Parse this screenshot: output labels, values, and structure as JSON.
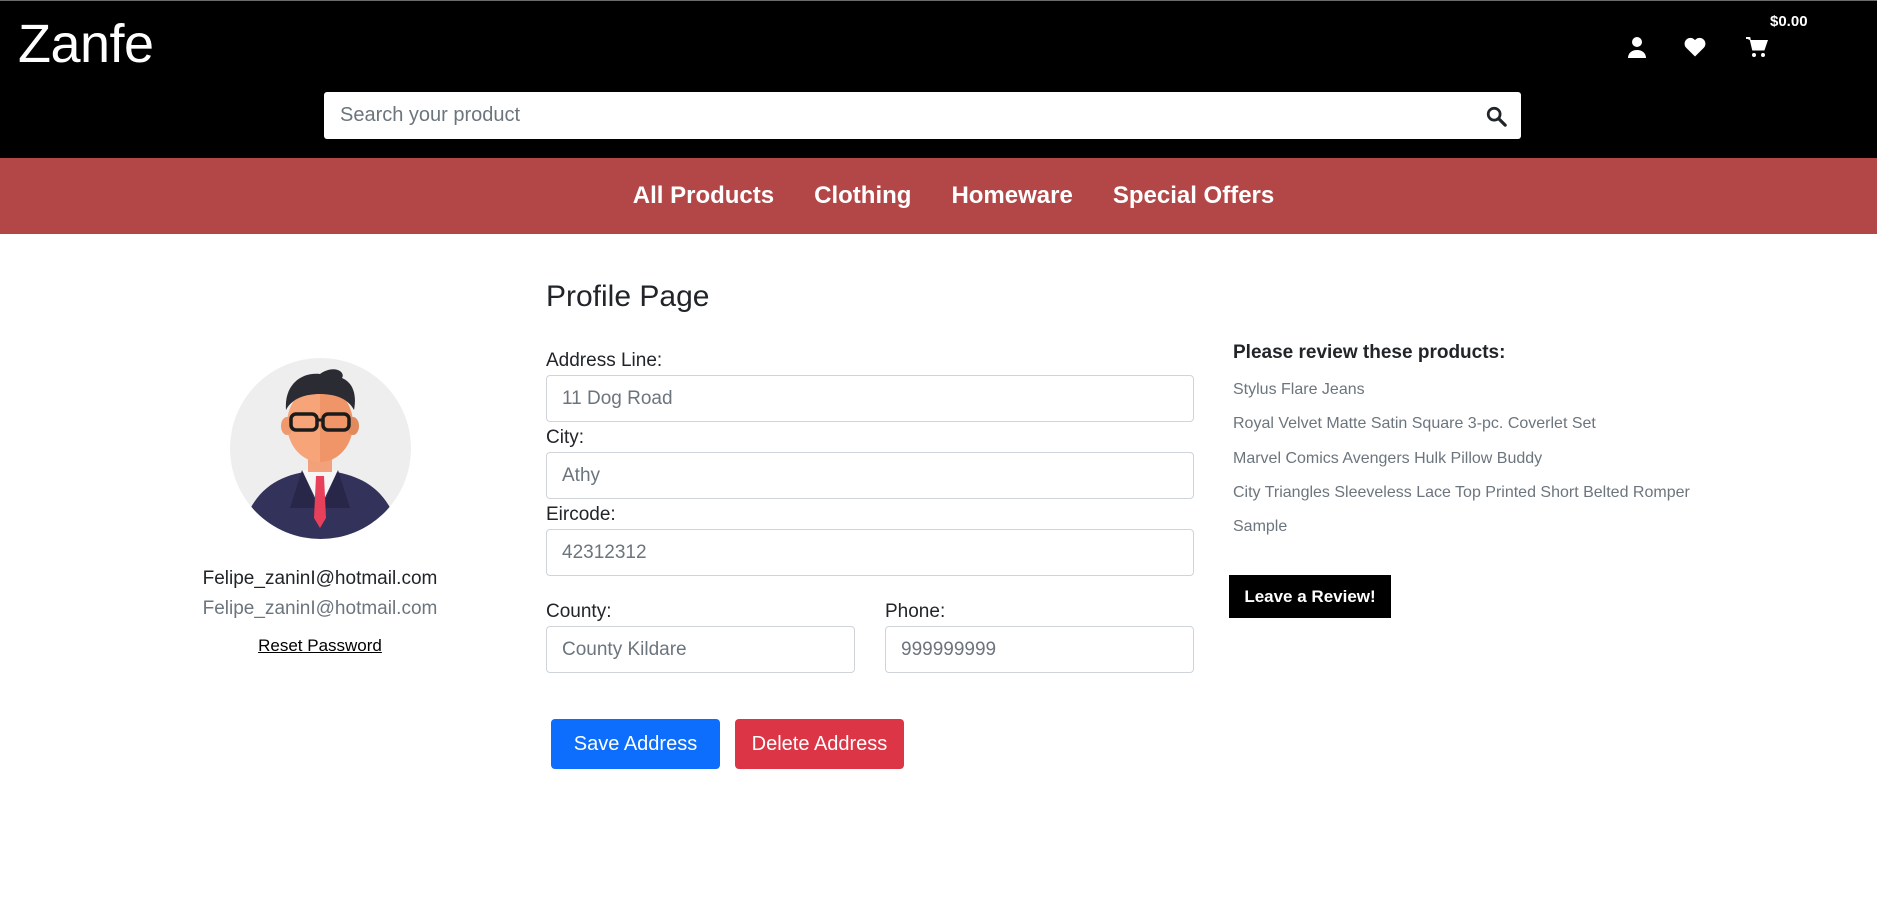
{
  "header": {
    "logo": "Zanfe",
    "cart_total": "$0.00",
    "icons": [
      "user-icon",
      "heart-icon",
      "cart-icon"
    ],
    "search_placeholder": "Search your product"
  },
  "nav": {
    "items": [
      "All Products",
      "Clothing",
      "Homeware",
      "Special Offers"
    ]
  },
  "profile": {
    "email": "Felipe_zaninI@hotmail.com",
    "email_secondary": "Felipe_zaninI@hotmail.com",
    "reset_password": "Reset Password"
  },
  "form": {
    "title": "Profile Page",
    "address_label": "Address Line:",
    "address_placeholder": "11 Dog Road",
    "city_label": "City:",
    "city_placeholder": "Athy",
    "eircode_label": "Eircode:",
    "eircode_placeholder": "42312312",
    "county_label": "County:",
    "county_placeholder": "County Kildare",
    "phone_label": "Phone:",
    "phone_placeholder": "999999999",
    "save_label": "Save Address",
    "delete_label": "Delete Address"
  },
  "reviews": {
    "heading": "Please review these products:",
    "items": [
      "Stylus Flare Jeans",
      "Royal Velvet Matte Satin Square 3-pc. Coverlet Set",
      "Marvel Comics Avengers Hulk Pillow Buddy",
      "City Triangles Sleeveless Lace Top Printed Short Belted Romper",
      "Sample"
    ],
    "button_label": "Leave a Review!"
  },
  "colors": {
    "header_bg": "#000000",
    "nav_bg": "#b34747",
    "save_btn": "#0d6efd",
    "delete_btn": "#dc3545"
  }
}
